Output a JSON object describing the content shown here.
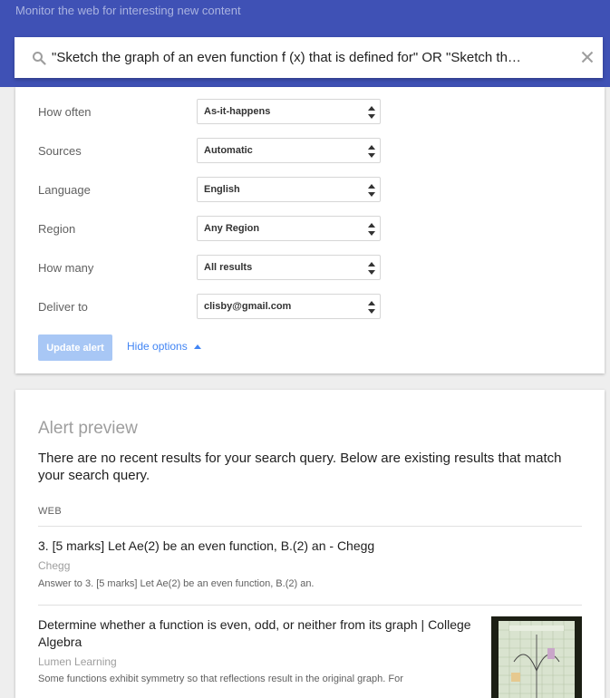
{
  "header": {
    "tagline": "Monitor the web for interesting new content",
    "query": "\"Sketch the graph of an even function f (x) that is defined for\" OR \"Sketch the graph of an even function f (x) that is defined for all\""
  },
  "options": {
    "rows": [
      {
        "label": "How often",
        "value": "As-it-happens"
      },
      {
        "label": "Sources",
        "value": "Automatic"
      },
      {
        "label": "Language",
        "value": "English"
      },
      {
        "label": "Region",
        "value": "Any Region"
      },
      {
        "label": "How many",
        "value": "All results"
      },
      {
        "label": "Deliver to",
        "value": "clisby@gmail.com"
      }
    ],
    "update_label": "Update alert",
    "hide_label": "Hide options"
  },
  "preview": {
    "title": "Alert preview",
    "message": "There are no recent results for your search query. Below are existing results that match your search query.",
    "section": "WEB",
    "results": [
      {
        "title": "3. [5 marks] Let Ae(2) be an even function, B.(2) an - Chegg",
        "source": "Chegg",
        "snippet": "Answer to 3. [5 marks] Let Ae(2) be an even function, B.(2) an."
      },
      {
        "title": "Determine whether a function is even, odd, or neither from its graph | College Algebra",
        "source": "Lumen Learning",
        "snippet": "Some functions exhibit symmetry so that reflections result in the original graph. For"
      }
    ]
  },
  "colors": {
    "header_bg": "#3f51b5",
    "accent": "#4285f4",
    "update_btn": "#a8c7f5"
  }
}
